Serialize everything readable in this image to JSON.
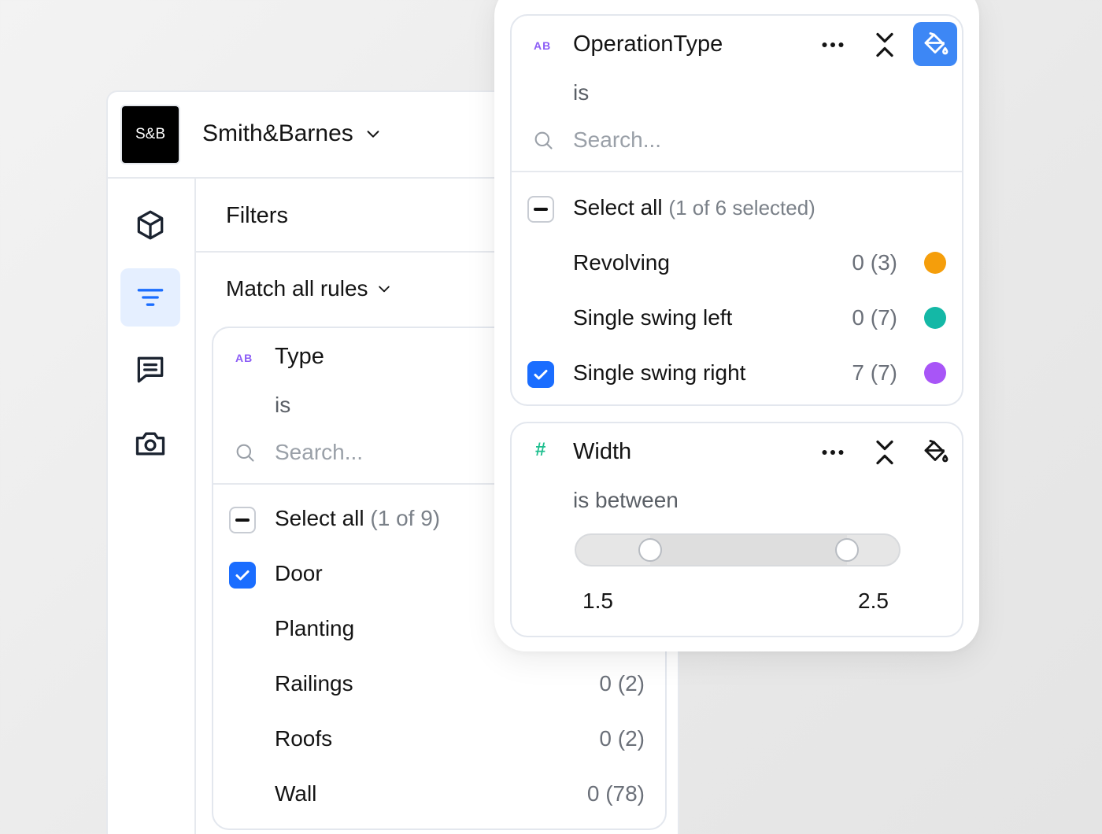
{
  "app": {
    "logo_text": "S&B",
    "company_name": "Smith&Barnes",
    "nav_icons": [
      "cube-icon",
      "filter-icon",
      "comment-icon",
      "camera-icon"
    ],
    "active_nav": "filter-icon",
    "accent_color": "#1a6dff"
  },
  "filters": {
    "title": "Filters",
    "match_label": "Match all rules",
    "type_card": {
      "type_badge": "AB",
      "field": "Type",
      "operator": "is",
      "search_placeholder": "Search...",
      "select_all_label": "Select all",
      "select_all_count": "(1 of 9)",
      "items": [
        {
          "label": "Door",
          "checked": true,
          "count": ""
        },
        {
          "label": "Planting",
          "checked": false,
          "count": ""
        },
        {
          "label": "Railings",
          "checked": false,
          "count": "0 (2)"
        },
        {
          "label": "Roofs",
          "checked": false,
          "count": "0 (2)"
        },
        {
          "label": "Wall",
          "checked": false,
          "count": "0 (78)"
        }
      ]
    }
  },
  "popover": {
    "operation_card": {
      "type_badge": "AB",
      "field": "OperationType",
      "operator": "is",
      "search_placeholder": "Search...",
      "select_all_label": "Select all",
      "select_all_count": "(1 of 6 selected)",
      "paint_active": true,
      "items": [
        {
          "label": "Revolving",
          "checked": false,
          "count": "0 (3)",
          "color": "#f59e0b"
        },
        {
          "label": "Single swing left",
          "checked": false,
          "count": "0 (7)",
          "color": "#14b8a6"
        },
        {
          "label": "Single swing right",
          "checked": true,
          "count": "7 (7)",
          "color": "#a855f7"
        }
      ]
    },
    "width_card": {
      "type_badge": "#",
      "field": "Width",
      "operator": "is between",
      "min_label": "1.5",
      "max_label": "2.5",
      "thumb_low_fraction": 0.23,
      "thumb_high_fraction": 0.84
    }
  }
}
